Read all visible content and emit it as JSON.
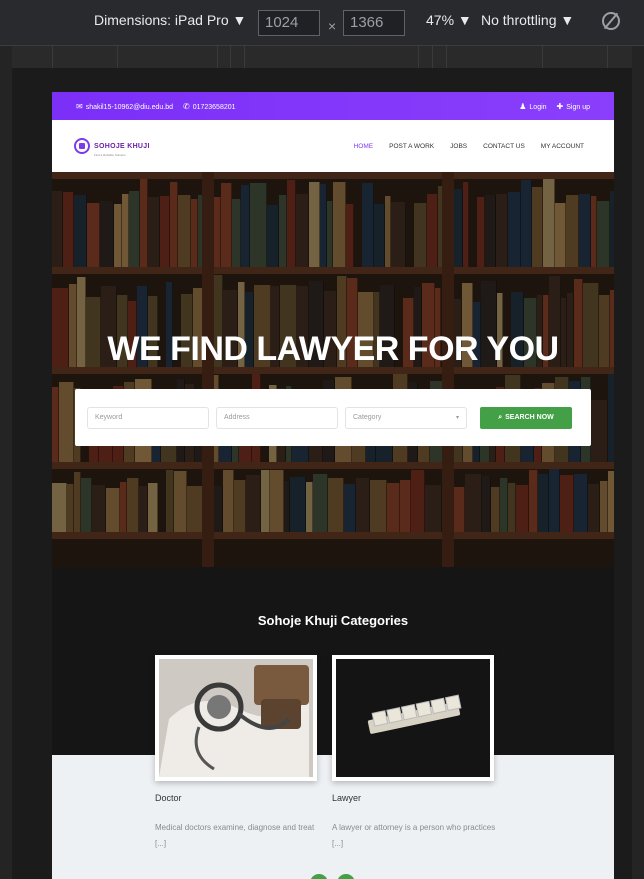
{
  "devtools": {
    "dimensions_label": "Dimensions: iPad Pro ▼",
    "width": "1024",
    "times": "×",
    "height": "1366",
    "zoom": "47% ▼",
    "throttling": "No throttling ▼",
    "rotate_icon": "rotate-icon"
  },
  "site": {
    "topbar": {
      "email": "shakil15-10962@diu.edu.bd",
      "phone": "01723658201",
      "login": "Login",
      "signup": "Sign up"
    },
    "logo": {
      "name": "SOHOJE KHUJI",
      "tagline": "Find a Reliable Solution"
    },
    "menu": [
      "HOME",
      "POST A WORK",
      "JOBS",
      "CONTACT US",
      "MY ACCOUNT"
    ],
    "hero": {
      "title": "WE FIND LAWYER FOR YOU",
      "keyword_placeholder": "Keyword",
      "address_placeholder": "Address",
      "category_placeholder": "Category",
      "search_button": "SEARCH NOW"
    },
    "categories": {
      "title": "Sohoje Khuji Categories",
      "items": [
        {
          "name": "Doctor",
          "desc": "Medical doctors examine, diagnose and treat [...]"
        },
        {
          "name": "Lawyer",
          "desc": "A lawyer or attorney is a person who practices [...]"
        }
      ]
    },
    "colors": {
      "topbar": "#7b2ff7",
      "accent": "#43a047",
      "nav_active": "#7c3aed"
    }
  }
}
